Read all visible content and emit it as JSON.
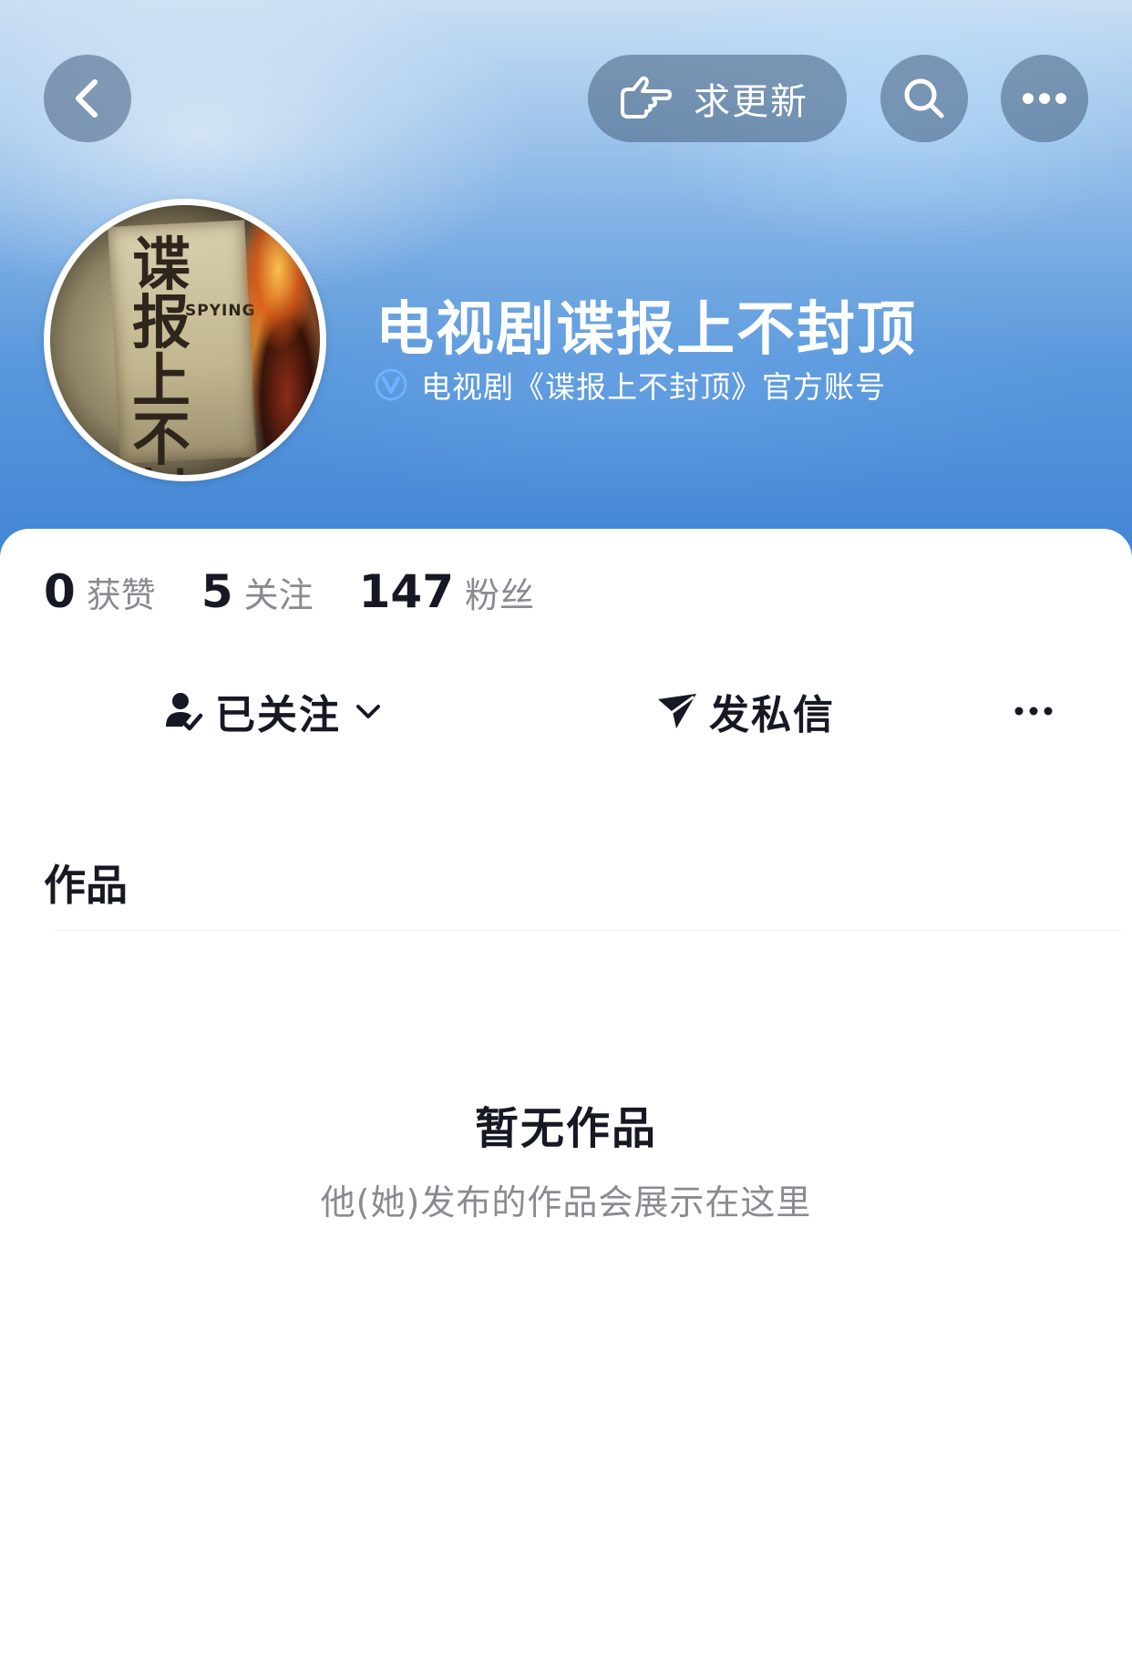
{
  "header": {
    "request_update_label": "求更新"
  },
  "profile": {
    "avatar_text": "谍报上不封顶",
    "avatar_subtext": "SPYING",
    "name": "电视剧谍报上不封顶",
    "verification": "电视剧《谍报上不封顶》官方账号"
  },
  "stats": [
    {
      "value": "0",
      "label": "获赞"
    },
    {
      "value": "5",
      "label": "关注"
    },
    {
      "value": "147",
      "label": "粉丝"
    }
  ],
  "actions": {
    "follow_label": "已关注",
    "message_label": "发私信"
  },
  "tabs": {
    "works_label": "作品"
  },
  "empty_state": {
    "title": "暂无作品",
    "subtitle": "他(她)发布的作品会展示在这里"
  },
  "colors": {
    "banner_top": "#c9dff4",
    "banner_bottom": "#3f83d4",
    "text_primary": "#161823",
    "text_secondary": "#8a8b91",
    "verify_badge": "#6fb2ff"
  },
  "icons": {
    "back": "chevron-left-icon",
    "request_update": "pointing-hand-icon",
    "search": "search-icon",
    "more": "more-dots-icon",
    "verified": "verified-v-icon",
    "followed": "user-check-icon",
    "dropdown": "chevron-down-icon",
    "message": "send-icon",
    "action_more": "more-dots-icon"
  }
}
